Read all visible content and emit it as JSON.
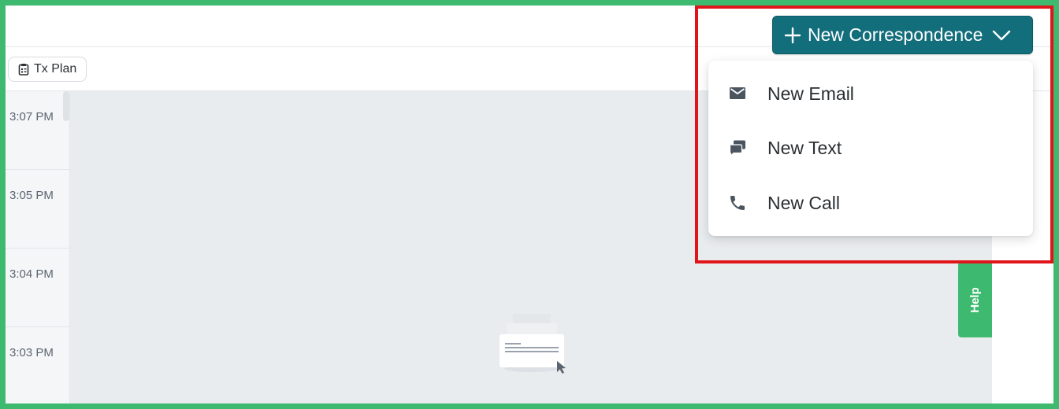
{
  "toolbar": {
    "tx_plan_label": "Tx Plan"
  },
  "timeline": {
    "times": [
      "3:07 PM",
      "3:05 PM",
      "3:04 PM",
      "3:03 PM"
    ]
  },
  "correspondence": {
    "button_label": "New Correspondence",
    "menu": {
      "email_label": "New Email",
      "text_label": "New Text",
      "call_label": "New Call"
    }
  },
  "help": {
    "label": "Help"
  },
  "colors": {
    "brand_teal": "#136e7c",
    "help_green": "#3dba6f",
    "highlight_red": "#e0151b"
  },
  "icons": [
    "clipboard-icon",
    "plus-icon",
    "chevron-down-icon",
    "email-icon",
    "chat-icon",
    "phone-icon",
    "empty-state-illustration"
  ]
}
